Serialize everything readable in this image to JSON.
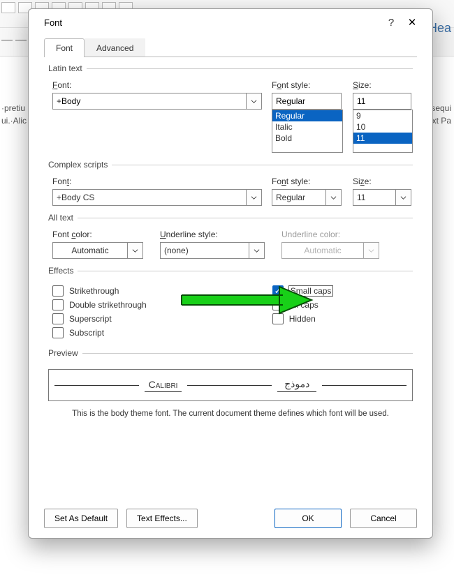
{
  "dialog": {
    "title": "Font",
    "help": "?",
    "close": "✕"
  },
  "tabs": {
    "font": "Font",
    "advanced": "Advanced"
  },
  "latin": {
    "legend": "Latin text",
    "font_label": "Font:",
    "font_value": "+Body",
    "style_label": "Font style:",
    "style_value": "Regular",
    "style_options": [
      "Regular",
      "Italic",
      "Bold"
    ],
    "size_label": "Size:",
    "size_value": "11",
    "size_options": [
      "9",
      "10",
      "11"
    ]
  },
  "complex": {
    "legend": "Complex scripts",
    "font_label": "Font:",
    "font_value": "+Body CS",
    "style_label": "Font style:",
    "style_value": "Regular",
    "size_label": "Size:",
    "size_value": "11"
  },
  "alltext": {
    "legend": "All text",
    "color_label": "Font color:",
    "color_value": "Automatic",
    "ustyle_label": "Underline style:",
    "ustyle_value": "(none)",
    "ucolor_label": "Underline color:",
    "ucolor_value": "Automatic"
  },
  "effects": {
    "legend": "Effects",
    "left": [
      "Strikethrough",
      "Double strikethrough",
      "Superscript",
      "Subscript"
    ],
    "right": [
      "Small caps",
      "All caps",
      "Hidden"
    ],
    "checked": "Small caps"
  },
  "preview": {
    "legend": "Preview",
    "sample1": "Calibri",
    "sample2": "دموذج",
    "note": "This is the body theme font. The current document theme defines which font will be used."
  },
  "buttons": {
    "default": "Set As Default",
    "texteffects": "Text Effects...",
    "ok": "OK",
    "cancel": "Cancel"
  },
  "bg": {
    "t1": "·pretiu",
    "t2": "ui.·Alic",
    "t3": "Hea",
    "t4": "sequi",
    "t5": "ext Pa"
  }
}
